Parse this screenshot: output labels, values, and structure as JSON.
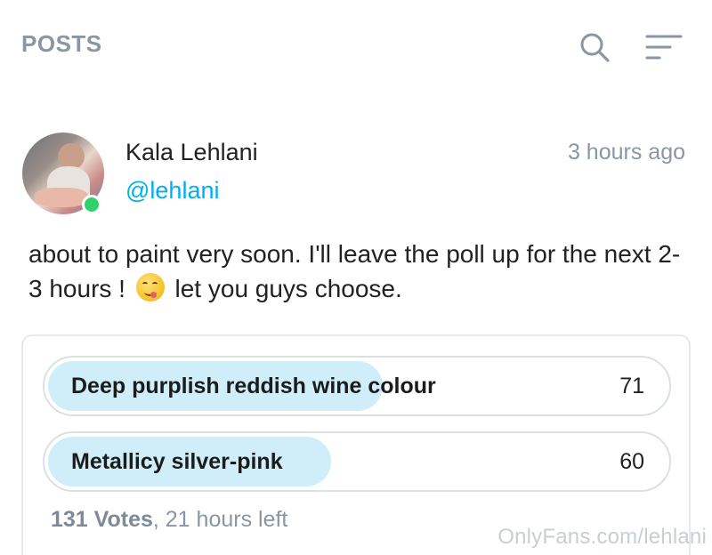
{
  "header": {
    "title": "POSTS",
    "search_icon": "search-icon",
    "filter_icon": "filter-lines-icon"
  },
  "post": {
    "author": {
      "name": "Kala Lehlani",
      "handle": "@lehlani",
      "online": true
    },
    "time": "3 hours ago",
    "text": {
      "before_emoji": "about to paint very soon. I'll leave the poll up for the next 2-3 hours ! ",
      "emoji": "smiling-face-savoring-food-icon",
      "after_emoji": " let you guys choose."
    }
  },
  "poll": {
    "options": [
      {
        "label": "Deep purplish reddish wine colour",
        "votes": "71",
        "fraction": 0.542
      },
      {
        "label": "Metallicy silver-pink",
        "votes": "60",
        "fraction": 0.458
      }
    ],
    "total_votes": "131 Votes",
    "time_left": ", 21 hours left"
  },
  "watermark": "OnlyFans.com/lehlani",
  "colors": {
    "accent": "#00aff0",
    "muted": "#8a96a3",
    "poll_fill": "#cfeef9",
    "online": "#2fd16b"
  }
}
